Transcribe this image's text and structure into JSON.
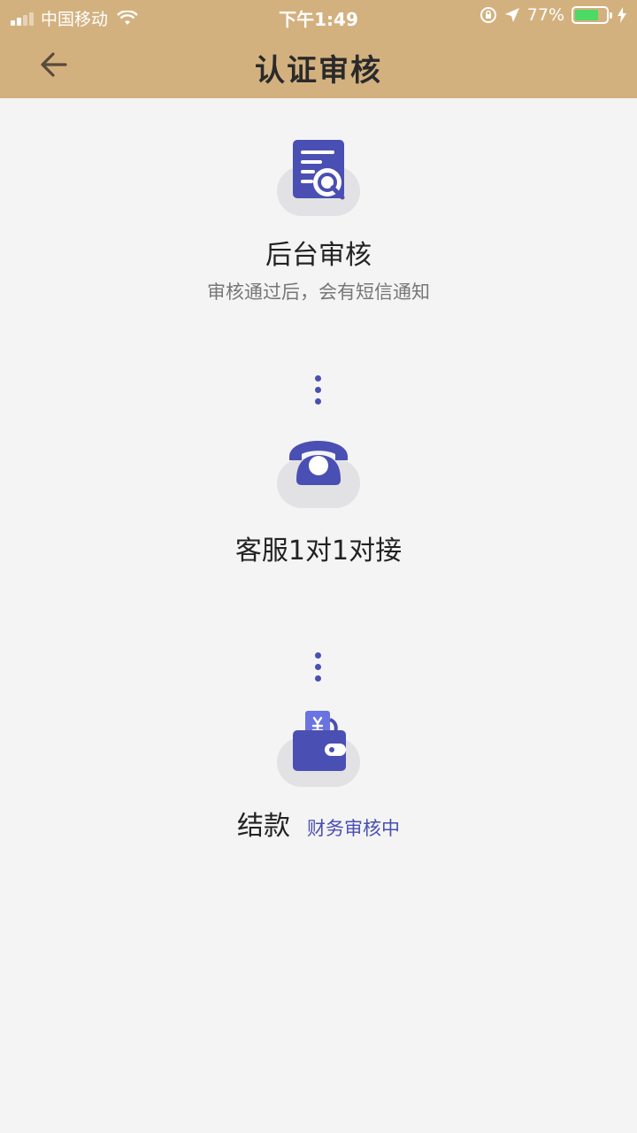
{
  "status_bar": {
    "carrier": "中国移动",
    "time": "下午1:49",
    "battery_text": "77%",
    "battery_level": 0.77
  },
  "header": {
    "title": "认证审核",
    "back_icon": "arrow-left-icon"
  },
  "steps": [
    {
      "label": "后台审核",
      "sub": "审核通过后，会有短信通知",
      "icon": "document-search-icon"
    },
    {
      "label": "客服1对1对接",
      "icon": "telephone-icon"
    },
    {
      "label": "结款",
      "status": "财务审核中",
      "icon": "wallet-icon"
    }
  ],
  "colors": {
    "header_bg": "#d3b17f",
    "accent": "#4a4fb3",
    "page_bg": "#f4f4f4"
  }
}
